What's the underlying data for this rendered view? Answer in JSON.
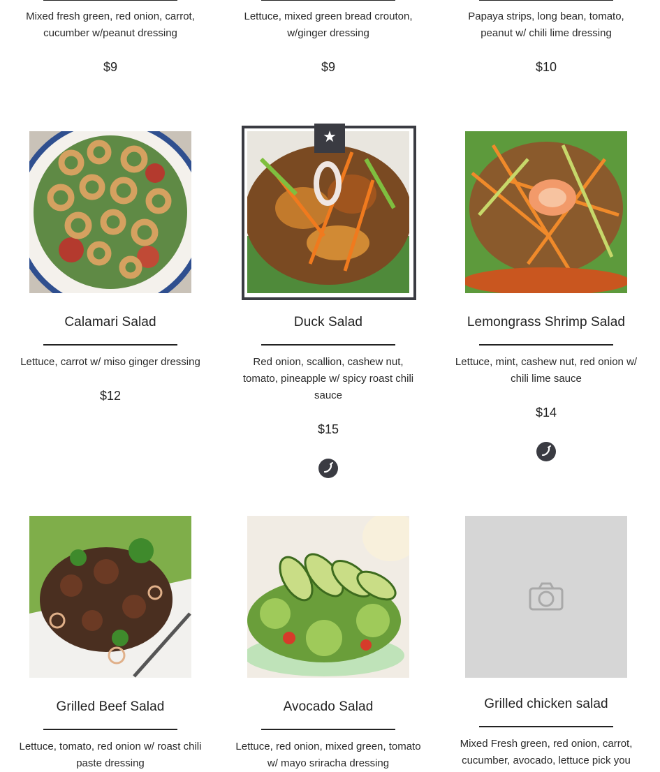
{
  "top_row": [
    {
      "description": "Mixed fresh green, red onion, carrot, cucumber w/peanut dressing",
      "price": "$9"
    },
    {
      "description": "Lettuce, mixed green bread crouton, w/ginger dressing",
      "price": "$9"
    },
    {
      "description": "Papaya strips, long bean, tomato, peanut w/ chili lime dressing",
      "price": "$10"
    }
  ],
  "middle_row": [
    {
      "name": "Calamari Salad",
      "description": "Lettuce, carrot w/ miso ginger dressing",
      "price": "$12",
      "photo": "calamari-salad-photo"
    },
    {
      "name": "Duck Salad",
      "description": "Red onion, scallion, cashew nut, tomato, pineapple w/ spicy roast chili sauce",
      "price": "$15",
      "photo": "duck-salad-photo",
      "featured": true,
      "badge_icon": "star-icon",
      "spicy_icon": "chili-pepper-icon"
    },
    {
      "name": "Lemongrass Shrimp Salad",
      "description": "Lettuce, mint, cashew nut, red onion w/ chili lime sauce",
      "price": "$14",
      "photo": "lemongrass-shrimp-salad-photo",
      "spicy_icon": "chili-pepper-icon"
    }
  ],
  "bottom_row": [
    {
      "name": "Grilled Beef Salad",
      "description": "Lettuce, tomato, red onion w/ roast chili paste dressing",
      "photo": "grilled-beef-salad-photo"
    },
    {
      "name": "Avocado Salad",
      "description": "Lettuce, red onion, mixed green, tomato w/ mayo sriracha dressing",
      "photo": "avocado-salad-photo"
    },
    {
      "name": "Grilled chicken salad",
      "description": "Mixed Fresh green, red onion, carrot, cucumber, avocado, lettuce pick you",
      "photo": "camera-placeholder-icon"
    }
  ],
  "colors": {
    "accent_dark": "#3a3b42",
    "placeholder_bg": "#d6d6d6"
  }
}
